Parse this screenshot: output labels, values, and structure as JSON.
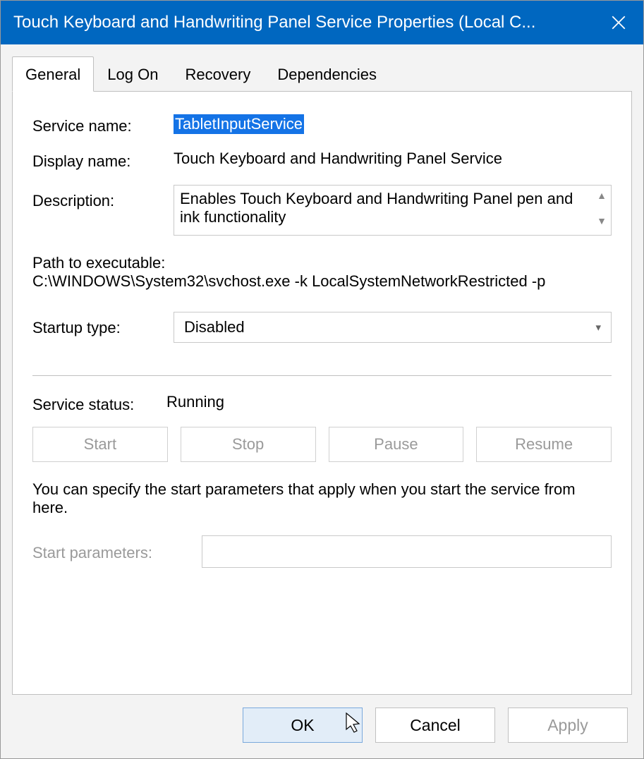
{
  "titlebar": {
    "title": "Touch Keyboard and Handwriting Panel Service Properties (Local C..."
  },
  "tabs": {
    "general": "General",
    "logon": "Log On",
    "recovery": "Recovery",
    "dependencies": "Dependencies"
  },
  "general": {
    "service_name_label": "Service name:",
    "service_name_value": "TabletInputService",
    "display_name_label": "Display name:",
    "display_name_value": "Touch Keyboard and Handwriting Panel Service",
    "description_label": "Description:",
    "description_value": "Enables Touch Keyboard and Handwriting Panel pen and ink functionality",
    "path_label": "Path to executable:",
    "path_value": "C:\\WINDOWS\\System32\\svchost.exe -k LocalSystemNetworkRestricted -p",
    "startup_type_label": "Startup type:",
    "startup_type_value": "Disabled",
    "status_label": "Service status:",
    "status_value": "Running",
    "buttons": {
      "start": "Start",
      "stop": "Stop",
      "pause": "Pause",
      "resume": "Resume"
    },
    "params_help": "You can specify the start parameters that apply when you start the service from here.",
    "params_label": "Start parameters:",
    "params_value": ""
  },
  "footer": {
    "ok": "OK",
    "cancel": "Cancel",
    "apply": "Apply"
  }
}
